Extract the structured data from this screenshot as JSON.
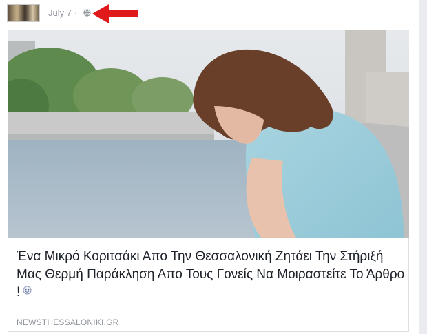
{
  "post": {
    "date": "July 7",
    "separator": "·",
    "headline": "Ένα Μικρό Κοριτσάκι Απο Την Θεσσαλονική Ζητάει Την Στήριξή Μας Θερμή Παράκληση Απο Τους Γονείς Να Μοιραστείτε Το Άρθρο !",
    "source": "NEWSTHESSALONIKI.GR"
  },
  "icons": {
    "audience": "globe-icon",
    "pointer": "red-arrow-icon",
    "headline_emoji": "smiley-icon"
  },
  "colors": {
    "arrow": "#e0191b",
    "meta_text": "#90949c",
    "headline_text": "#1d2129"
  }
}
